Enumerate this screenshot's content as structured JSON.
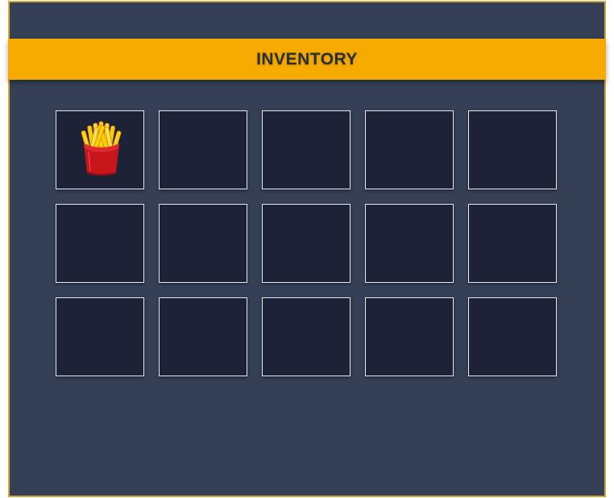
{
  "header": {
    "title": "INVENTORY"
  },
  "inventory": {
    "columns": 5,
    "rows": 3,
    "slots": [
      {
        "item": "french-fries-icon"
      },
      {
        "item": null
      },
      {
        "item": null
      },
      {
        "item": null
      },
      {
        "item": null
      },
      {
        "item": null
      },
      {
        "item": null
      },
      {
        "item": null
      },
      {
        "item": null
      },
      {
        "item": null
      },
      {
        "item": null
      },
      {
        "item": null
      },
      {
        "item": null
      },
      {
        "item": null
      },
      {
        "item": null
      }
    ]
  },
  "colors": {
    "panel_bg": "#353f56",
    "panel_border": "#d9a63a",
    "title_bar": "#f7ab00",
    "slot_bg": "#1d2236",
    "slot_border": "#e7e9ee"
  }
}
